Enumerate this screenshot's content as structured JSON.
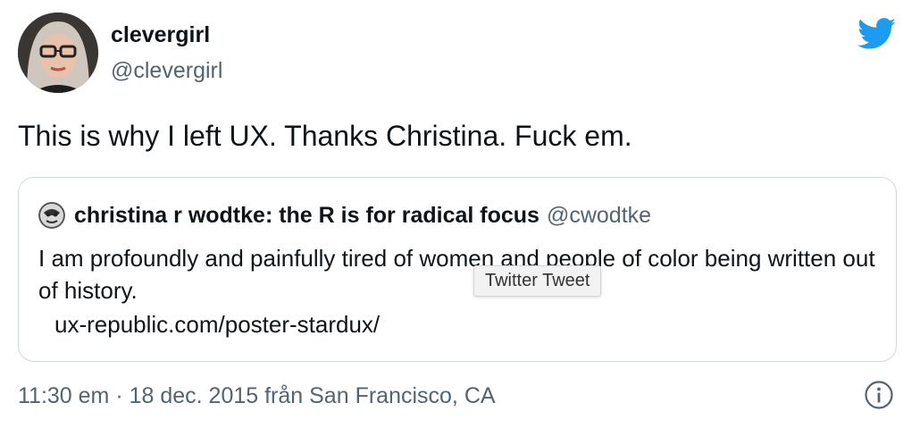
{
  "author": {
    "display_name": "clevergirl",
    "handle": "@clevergirl"
  },
  "tweet": {
    "text": "This is why I left UX. Thanks Christina. Fuck em."
  },
  "quoted_tweet": {
    "display_name": "christina r wodtke: the R is for radical focus",
    "handle": "@cwodtke",
    "text": "I am profoundly and painfully tired of women and people of color being written out of history.",
    "link": "ux-republic.com/poster-stardux/"
  },
  "tooltip": {
    "text": "Twitter Tweet"
  },
  "footer": {
    "timestamp": "11:30 em · 18 dec. 2015 från San Francisco, CA"
  },
  "icons": {
    "logo": "twitter-bird-icon",
    "info": "info-icon"
  },
  "colors": {
    "brand": "#1d9bf0",
    "text": "#0f1419",
    "secondary_text": "#536471",
    "border": "#cfd9de"
  }
}
